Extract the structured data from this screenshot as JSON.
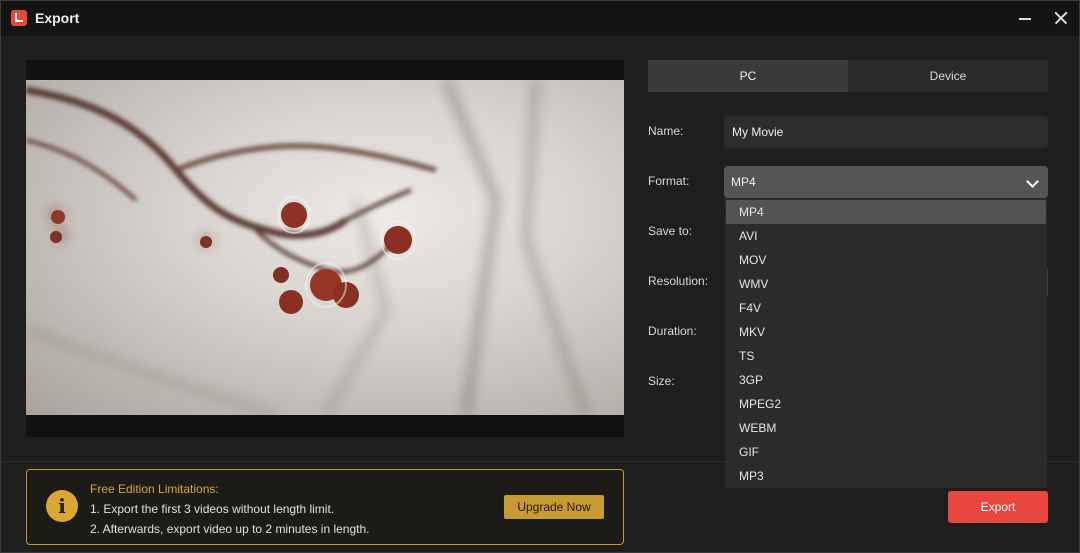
{
  "window": {
    "title": "Export"
  },
  "tabs": [
    {
      "label": "PC",
      "active": true
    },
    {
      "label": "Device",
      "active": false
    }
  ],
  "fields": {
    "name_label": "Name:",
    "name_value": "My Movie",
    "format_label": "Format:",
    "format_value": "MP4",
    "save_to_label": "Save to:",
    "resolution_label": "Resolution:",
    "duration_label": "Duration:",
    "size_label": "Size:"
  },
  "format_options": [
    "MP4",
    "AVI",
    "MOV",
    "WMV",
    "F4V",
    "MKV",
    "TS",
    "3GP",
    "MPEG2",
    "WEBM",
    "GIF",
    "MP3"
  ],
  "limitations": {
    "title": "Free Edition Limitations:",
    "line1": "1. Export the first 3 videos without length limit.",
    "line2": "2. Afterwards, export video up to 2 minutes in length.",
    "upgrade_label": "Upgrade Now"
  },
  "export_label": "Export",
  "colors": {
    "accent": "#e8463f",
    "warning": "#c89a34",
    "background": "#1e1e1e"
  }
}
